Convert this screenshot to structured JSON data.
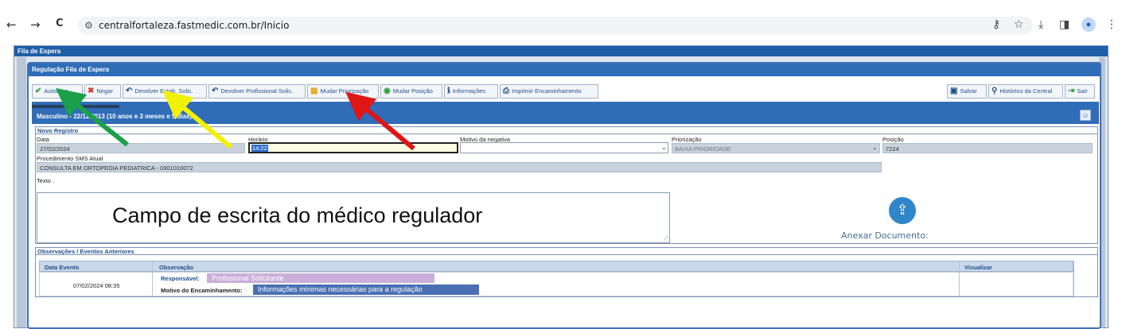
{
  "browser": {
    "back": "←",
    "forward": "→",
    "reload": "C",
    "url": "centralfortaleza.fastmedic.com.br/Inicio"
  },
  "app": {
    "title": "Fila de Espera",
    "panel_title": "Regulação Fila de Espera"
  },
  "toolbar": {
    "autorizar": "Autorizar",
    "negar": "Negar",
    "devolver_estab": "Devolver Estab. Solic.",
    "devolver_prof": "Devolver Profissional Solic.",
    "mudar_priorizacao": "Mudar Priorização",
    "mudar_posicao": "Mudar Posição",
    "informacoes": "Informações",
    "imprimir": "Imprimir Encaminhamento",
    "salvar": "Salvar",
    "historico": "Histórico da Central",
    "sair": "Sair"
  },
  "patient": {
    "info": "Masculino - 22/11/2013 (10 anos e 3 meses e 5 dias)"
  },
  "novo_registro": {
    "title": "Novo Registro",
    "data_label": "Data",
    "data_value": "27/02/2024",
    "horario_label": "Horário",
    "horario_value": "14:22",
    "motivo_label": "Motivo da negativa",
    "motivo_value": "",
    "priorizacao_label": "Priorização",
    "priorizacao_value": "BAIXA PRIORIDADE",
    "posicao_label": "Posição",
    "posicao_value": "7224",
    "procedimento_label": "Procedimento SMS Atual",
    "procedimento_value": "CONSULTA EM ORTOPEDIA PEDIATRICA - 0301010072",
    "texto_label": "Texto",
    "texto_overlay": "Campo de escrita do médico regulador",
    "anexar": "Anexar Documento:"
  },
  "observacoes": {
    "title": "Observações / Eventos Anteriores",
    "headers": [
      "Data Evento",
      "Observação",
      "Visualizar"
    ],
    "rows": [
      {
        "data_evento": "07/02/2024 08:35",
        "responsavel_label": "Responsável:",
        "responsavel_value": "Profissional Solicitante",
        "motivo_label": "Motivo do Encaminhamento:",
        "motivo_value": "Informações mínimas necessárias para a regulação"
      }
    ]
  },
  "colors": {
    "header_blue": "#2f6db8",
    "arrow_green": "#1aa04a",
    "arrow_yellow": "#f2f200",
    "arrow_red": "#e01515"
  }
}
